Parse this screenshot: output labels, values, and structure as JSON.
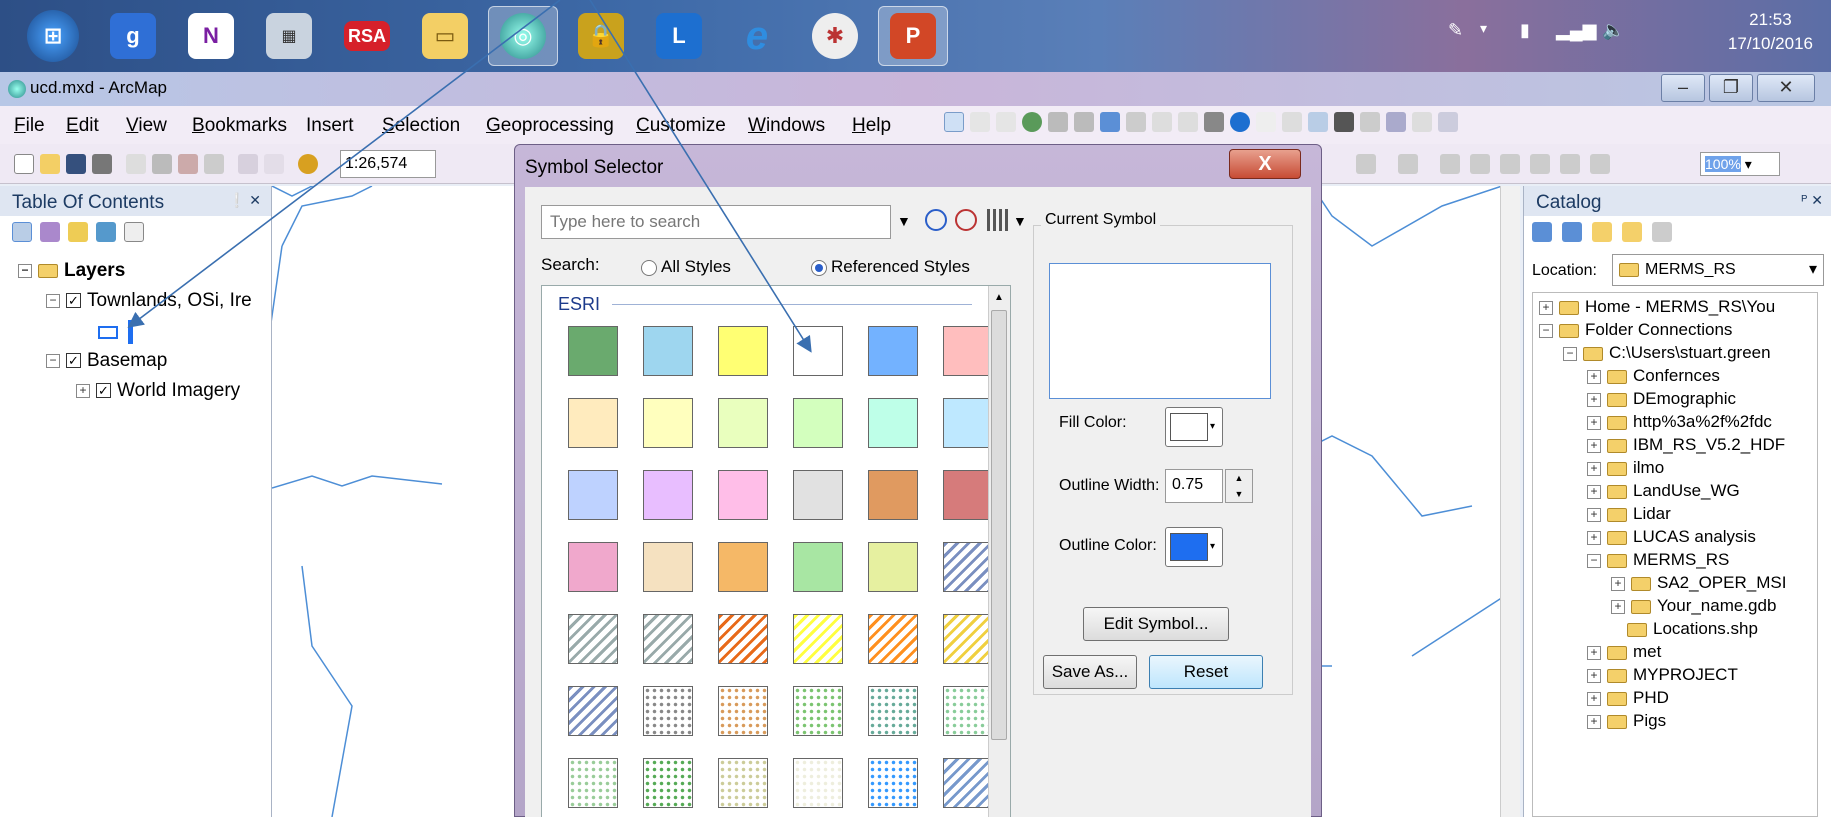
{
  "taskbar": {
    "rsa_label": "RSA",
    "clock_time": "21:53",
    "clock_date": "17/10/2016"
  },
  "app": {
    "title": "ucd.mxd - ArcMap"
  },
  "menu": [
    {
      "label": "File",
      "key": "F",
      "rest": "ile"
    },
    {
      "label": "Edit",
      "key": "E",
      "rest": "dit"
    },
    {
      "label": "View",
      "key": "V",
      "rest": "iew"
    },
    {
      "label": "Bookmarks",
      "key": "B",
      "rest": "ookmarks"
    },
    {
      "label": "Insert",
      "key": "",
      "rest": "Insert"
    },
    {
      "label": "Selection",
      "key": "S",
      "rest": "election"
    },
    {
      "label": "Geoprocessing",
      "key": "G",
      "rest": "eoprocessing"
    },
    {
      "label": "Customize",
      "key": "C",
      "rest": "ustomize"
    },
    {
      "label": "Windows",
      "key": "W",
      "rest": "indows"
    },
    {
      "label": "Help",
      "key": "H",
      "rest": "elp"
    }
  ],
  "toolbar": {
    "scale": "1:26,574",
    "zoom": "100%"
  },
  "toc": {
    "title": "Table Of Contents",
    "pin": "❕ ✕",
    "layers": "Layers",
    "townlands": "Townlands, OSi, Ire",
    "basemap": "Basemap",
    "imagery": "World Imagery"
  },
  "dialog": {
    "title": "Symbol Selector",
    "close": "X",
    "search_placeholder": "Type here to search",
    "search_label": "Search:",
    "all_styles": "All Styles",
    "referenced_styles": "Referenced Styles",
    "gallery_group": "ESRI",
    "current_symbol": "Current Symbol",
    "fill_label": "Fill Color:",
    "outline_width_label": "Outline Width:",
    "outline_width": "0.75",
    "outline_color_label": "Outline Color:",
    "edit_symbol": "Edit Symbol...",
    "save_as": "Save As...",
    "reset": "Reset",
    "fill_color": "#ffffff",
    "outline_color": "#1e6ef0"
  },
  "catalog": {
    "title": "Catalog",
    "location_label": "Location:",
    "location": "MERMS_RS",
    "items": [
      "Home - MERMS_RS\\You",
      "Folder Connections",
      "C:\\Users\\stuart.green",
      "Confernces",
      "DEmographic",
      "http%3a%2f%2fdc",
      "IBM_RS_V5.2_HDF",
      "ilmo",
      "LandUse_WG",
      "Lidar",
      "LUCAS analysis",
      "MERMS_RS",
      "SA2_OPER_MSI",
      "Your_name.gdb",
      "Locations.shp",
      "met",
      "MYPROJECT",
      "PHD",
      "Pigs"
    ]
  },
  "swatches": [
    [
      "#6aaa6e",
      "#9ed6ef",
      "#ffff73",
      "#ffffff",
      "#73b2ff",
      "#ffbebe"
    ],
    [
      "#ffebbe",
      "#ffffbe",
      "#e9ffbe",
      "#d3ffbe",
      "#beffe8",
      "#bee8ff"
    ],
    [
      "#bed2ff",
      "#e8beff",
      "#ffbee8",
      "#e1e1e1",
      "#e09a60",
      "#d67b7b"
    ],
    [
      "#f0a8cc",
      "#f5e1c0",
      "#f5b867",
      "#a8e6a3",
      "#e6f0a0",
      "hatch:#7a8fc0"
    ],
    [
      "hatch:#9aa",
      "hatch:#9aa",
      "hatch:#e86a1a",
      "hatch:#ffff40",
      "hatch:#ff9020",
      "hatch:#f0d040"
    ],
    [
      "hatch:#7a8fc0",
      "dots:#888",
      "dots:#d89a5a",
      "dots:#7bc470",
      "dots:#6a9",
      "dots:#8c9"
    ],
    [
      "dots:#9c9",
      "dots:#5a5",
      "dots:#cc9",
      "dots:#eed",
      "dots:#39f",
      "hatch:#79c"
    ]
  ]
}
